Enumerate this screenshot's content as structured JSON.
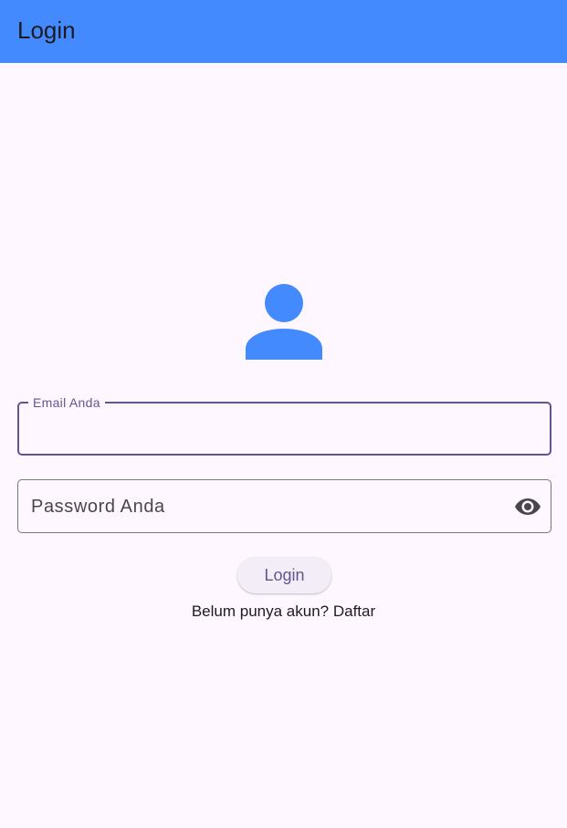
{
  "appbar": {
    "title": "Login",
    "color": "#448AFF"
  },
  "avatar": {
    "icon": "person-icon",
    "color": "#448AFF"
  },
  "email_field": {
    "label": "Email Anda",
    "value": "",
    "state": "focused"
  },
  "password_field": {
    "placeholder": "Password Anda",
    "value": "",
    "visibility_icon": "eye-icon"
  },
  "login_button": {
    "label": "Login"
  },
  "register_link": {
    "text": "Belum punya akun? Daftar"
  },
  "colors": {
    "background": "#FEF7FF",
    "primary": "#65558F",
    "outline": "#79747E"
  }
}
